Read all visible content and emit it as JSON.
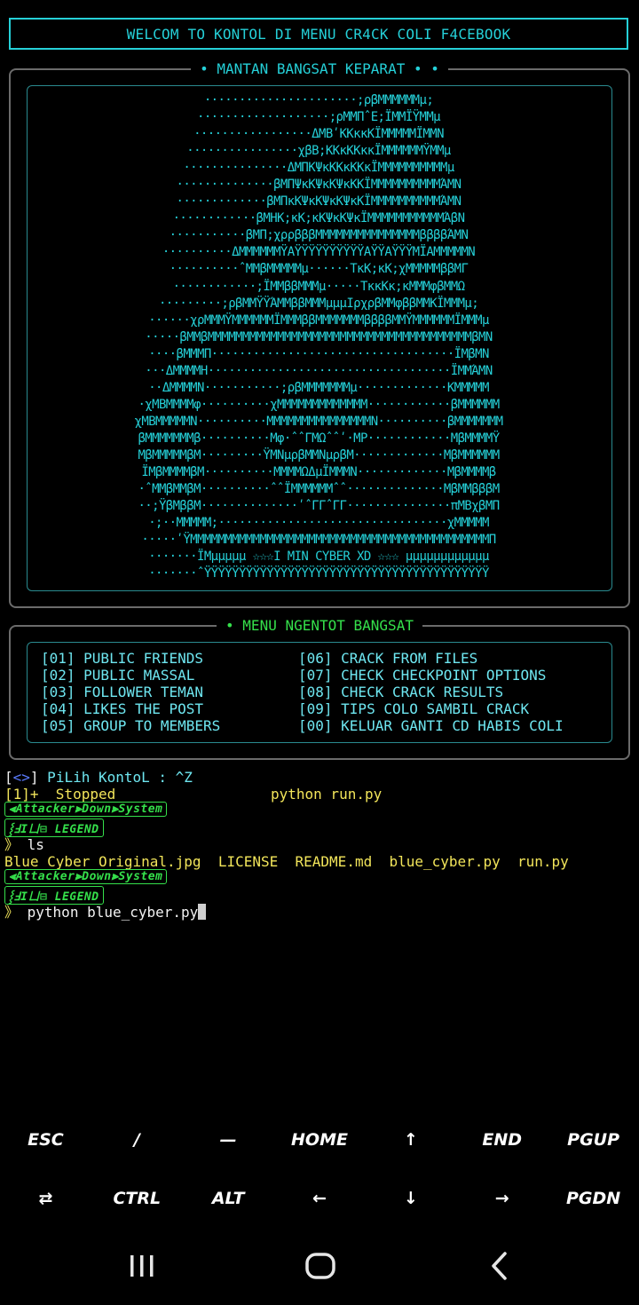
{
  "header": {
    "title": "WELCOM TO KONTOL DI MENU CR4CK COLI F4CEBOOK"
  },
  "art_panel": {
    "legend": "• MANTAN BANGSAT KEPARAT • •",
    "lines": [
      "······················;ρβMMMMMMμ;",
      "···················;ρMMΠˆE;ÏMMÏŸMMμ",
      "·················ΔMBʹKKκκKÏMMMMMÏMMN",
      "················χβB;KKκKKκκÏMMMMMMŸMMμ",
      "···············ΔMΠKΨκKKκKKκÏMMMMMMMMMMμ",
      "··············βMΠΨκKΨκKΨκKKÏMMMMMMMMMMΆMN",
      "·············βMΠκKΨκKΨκKΨκKÏMMMMMMMMMMΆMN",
      "············βMHK;κK;κKΨκKΨκÏMMMMMMMMMMMΆβN",
      "···········βMΠ;χρρβββMMMMMMMMMMMMMMMββββΆMN",
      "··········ΔMMMMMMΫΑΫΫΫΫΫΫΫΫΫΫΑΫΫΑΫΫΫMΪΑMMMMMN",
      "··········ˆMMβMMMMMμ······TκK;κK;χMMMMMββMΓ",
      "············;ÏMMββMMMμ·····TκκKκ;κMMMφβMMΩ",
      "·········;ρβMMŸŸΆMMββMMMμμμIρχρβMMφββMMKÏMMMμ;",
      "······χρMMMŸMMMMMMÏMMMββMMMMMMMββββMMŸMMMMMMÏMMMμ",
      "·····βMMβMMMMMMMMMMMMMMMMMMMMMMMMMMMMMMMMMMMMMMβMN",
      "····βMMMΠ···································ÏMβMN",
      "···ΔMMMMH···································ÏMMΆMN",
      "··ΔMMMMN···········;ρβMMMMMMMμ·············KMMMMM",
      "·χMBMMMMφ··········χMMMMMMMMMMMMM············βMMMMMM",
      "χMBMMMMMN··········MMMMMMMMMMMMMMMN··········βMMMMMMM",
      "βMMMMMMMβ··········Mφ·ˆˆΓMΩˆˆʹ·MP············MβMMMMŸ",
      "MβMMMMMβM·········ŸMNμρβMMNμρβM·············MβMMMMMM",
      "ÏMβMMMMβM··········MMMMΩΔμÏMMMN·············MβMMMMβ",
      "·ˆMMβMMβM··········ˆˆÏMMMMMMˆˆ··············MβMMβββM",
      "··;ŸβMββM··············ʹˆΓΓˆΓΓ···············πMBχβMΠ",
      "·;··MMMMM;·································χMMMMM",
      "·····ʹŸMMMMMMMMMMMMMMMMMMMMMMMMMMMMMMMMMMMMMMMMMMMΠ",
      "·······ÏMμμμμμ ☆☆☆I MIN CYBER XD ☆☆☆ μμμμμμμμμμμμ",
      "·······ˆΫΫΫΫΫΫΫΫΫΫΫΫΫΫΫΫΫΫΫΫΫΫΫΫΫΫΫΫΫΫΫΫΫΫΫΫΫΫΫΫΫ"
    ]
  },
  "menu_panel": {
    "legend": "• MENU NGENTOT BANGSAT",
    "left_items": [
      "[01] PUBLIC FRIENDS",
      "[02] PUBLIC MASSAL",
      "[03] FOLLOWER TEMAN",
      "[04] LIKES THE POST",
      "[05] GROUP TO MEMBERS"
    ],
    "right_items": [
      "[06] CRACK FROM FILES",
      "[07] CHECK CHECKPOINT OPTIONS",
      "[08] CHECK CRACK RESULTS",
      "[09] TIPS COLO SAMBIL CRACK",
      "[00] KELUAR GANTI CD HABIS COLI"
    ]
  },
  "terminal": {
    "prompt_bracket_open": "[",
    "prompt_symbol": "<>",
    "prompt_bracket_close": "]",
    "prompt_text": " PiLih KontoL : ^Z",
    "stopped_job": "[1]+  Stopped",
    "stopped_cmd": "python run.py",
    "banner_top": "⫷Attacker⫸Down⫸System",
    "banner_bottom": "⸾ℲIㄩ⊟ LEGEND",
    "prompt_arrow": "》",
    "cmd_ls": " ls",
    "files": "Blue_Cyber_Original.jpg  LICENSE  README.md  blue_cyber.py  run.py",
    "cmd_current": " python blue_cyber.py"
  },
  "extra_keys": {
    "row1": [
      "ESC",
      "/",
      "—",
      "HOME",
      "↑",
      "END",
      "PGUP"
    ],
    "row2": [
      "⇄",
      "CTRL",
      "ALT",
      "←",
      "↓",
      "→",
      "PGDN"
    ]
  }
}
